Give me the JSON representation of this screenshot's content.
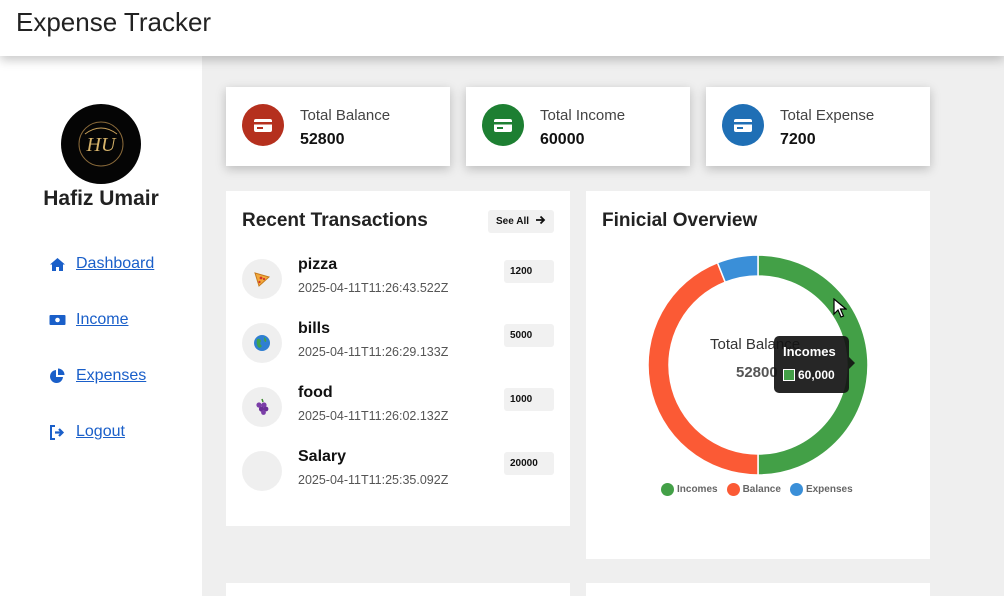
{
  "app": {
    "title": "Expense Tracker"
  },
  "user": {
    "name": "Hafiz Umair",
    "avatar_text": "HU"
  },
  "nav": [
    {
      "label": "Dashboard",
      "icon": "home-icon"
    },
    {
      "label": "Income",
      "icon": "money-bill-icon"
    },
    {
      "label": "Expenses",
      "icon": "pie-chart-icon"
    },
    {
      "label": "Logout",
      "icon": "logout-icon"
    }
  ],
  "stats": [
    {
      "label": "Total Balance",
      "value": "52800",
      "color": "#b5301e",
      "icon": "credit-card-icon"
    },
    {
      "label": "Total Income",
      "value": "60000",
      "color": "#1d7f32",
      "icon": "credit-card-icon"
    },
    {
      "label": "Total Expense",
      "value": "7200",
      "color": "#1f6fb5",
      "icon": "credit-card-icon"
    }
  ],
  "recent": {
    "title": "Recent Transactions",
    "see_all": "See All",
    "items": [
      {
        "name": "pizza",
        "date": "2025-04-11T11:26:43.522Z",
        "amount": "1200",
        "icon": "pizza-icon"
      },
      {
        "name": "bills",
        "date": "2025-04-11T11:26:29.133Z",
        "amount": "5000",
        "icon": "globe-icon"
      },
      {
        "name": "food",
        "date": "2025-04-11T11:26:02.132Z",
        "amount": "1000",
        "icon": "grapes-icon"
      },
      {
        "name": "Salary",
        "date": "2025-04-11T11:25:35.092Z",
        "amount": "20000",
        "icon": ""
      }
    ]
  },
  "overview": {
    "title": "Finicial Overview",
    "center_label": "Total Balance",
    "center_value": "52800",
    "tooltip": {
      "title": "Incomes",
      "value": "60,000"
    }
  },
  "chart_data": {
    "type": "pie",
    "donut": true,
    "categories": [
      "Incomes",
      "Balance",
      "Expenses"
    ],
    "values": [
      60000,
      52800,
      7200
    ],
    "colors": [
      "#43a047",
      "#fb5a35",
      "#3a8fd8"
    ],
    "legend_position": "bottom"
  }
}
